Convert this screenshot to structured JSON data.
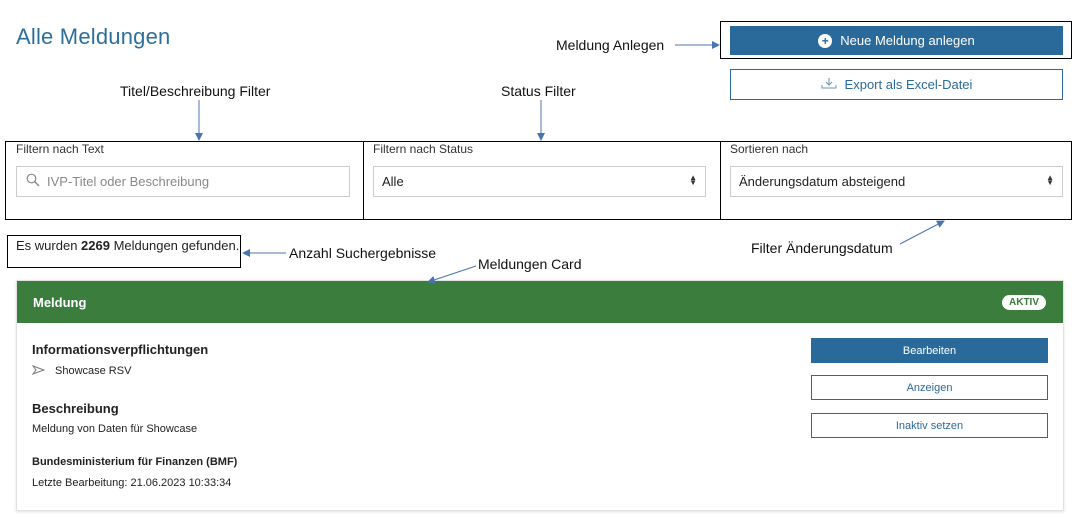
{
  "page_title": "Alle Meldungen",
  "actions": {
    "new_button": "Neue Meldung anlegen",
    "export_button": "Export als Excel-Datei"
  },
  "annotations": {
    "meldung_anlegen": "Meldung Anlegen",
    "title_filter": "Titel/Beschreibung Filter",
    "status_filter": "Status Filter",
    "anzahl": "Anzahl Suchergebnisse",
    "card": "Meldungen Card",
    "aenderungsdatum": "Filter Änderungsdatum"
  },
  "filters": {
    "text": {
      "label": "Filtern nach Text",
      "placeholder": "IVP-Titel oder Beschreibung"
    },
    "status": {
      "label": "Filtern nach Status",
      "value": "Alle"
    },
    "sort": {
      "label": "Sortieren nach",
      "value": "Änderungsdatum absteigend"
    }
  },
  "results": {
    "prefix": "Es wurden ",
    "count": "2269",
    "suffix": " Meldungen gefunden."
  },
  "card": {
    "header": "Meldung",
    "badge": "AKTIV",
    "info_title": "Informationsverpflichtungen",
    "info_item": "Showcase RSV",
    "desc_title": "Beschreibung",
    "desc_text": "Meldung von Daten für Showcase",
    "org": "Bundesministerium für Finanzen (BMF)",
    "last_edit": "Letzte Bearbeitung: 21.06.2023 10:33:34",
    "buttons": {
      "edit": "Bearbeiten",
      "view": "Anzeigen",
      "deactivate": "Inaktiv setzen"
    }
  },
  "colors": {
    "primary": "#2a6a9a",
    "card_header": "#3a7d3c",
    "title": "#2e6f9a"
  }
}
